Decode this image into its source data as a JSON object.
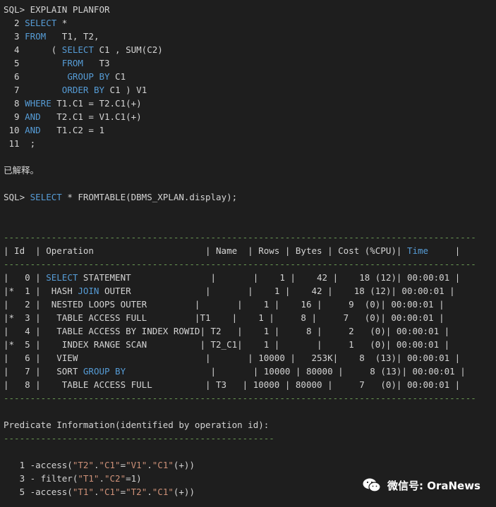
{
  "colors": {
    "background": "#1e1e1e",
    "text": "#d4d4d4",
    "keyword": "#569cd6",
    "string": "#ce9178",
    "separator": "#6a9955"
  },
  "lines": [
    [
      [
        "SQL> EXPLAIN PLANFOR",
        ""
      ]
    ],
    [
      [
        "  2 ",
        ""
      ],
      [
        "SELECT",
        "kw"
      ],
      [
        " *",
        ""
      ]
    ],
    [
      [
        "  3 ",
        ""
      ],
      [
        "FROM",
        "kw"
      ],
      [
        "   T1, T2,",
        ""
      ]
    ],
    [
      [
        "  4      ( ",
        ""
      ],
      [
        "SELECT",
        "kw"
      ],
      [
        " C1 , SUM(C2)",
        ""
      ]
    ],
    [
      [
        "  5        ",
        ""
      ],
      [
        "FROM",
        "kw"
      ],
      [
        "   T3",
        ""
      ]
    ],
    [
      [
        "  6         ",
        ""
      ],
      [
        "GROUP BY",
        "kw"
      ],
      [
        " C1",
        ""
      ]
    ],
    [
      [
        "  7        ",
        ""
      ],
      [
        "ORDER BY",
        "kw"
      ],
      [
        " C1 ) V1",
        ""
      ]
    ],
    [
      [
        "  8 ",
        ""
      ],
      [
        "WHERE",
        "kw"
      ],
      [
        " T1.C1 = T2.C1(+)",
        ""
      ]
    ],
    [
      [
        "  9 ",
        ""
      ],
      [
        "AND",
        "kw"
      ],
      [
        "   T2.C1 = V1.C1(+)",
        ""
      ]
    ],
    [
      [
        " 10 ",
        ""
      ],
      [
        "AND",
        "kw"
      ],
      [
        "   T1.C2 = 1",
        ""
      ]
    ],
    [
      [
        " 11  ;",
        ""
      ]
    ],
    [],
    [
      [
        "已解释。",
        ""
      ]
    ],
    [],
    [
      [
        "SQL> ",
        ""
      ],
      [
        "SELECT",
        "kw"
      ],
      [
        " * FROMTABLE(DBMS_XPLAN.display);",
        ""
      ]
    ],
    [],
    [],
    [
      [
        "-----------------------------------------------------------------------------------------",
        "dash"
      ]
    ],
    [
      [
        "| Id  | Operation                     | Name  | Rows | Bytes | Cost (%CPU)| ",
        ""
      ],
      [
        "Time",
        "kw"
      ],
      [
        "     |",
        ""
      ]
    ],
    [
      [
        "-----------------------------------------------------------------------------------------",
        "dash"
      ]
    ],
    [
      [
        "|   0 | ",
        ""
      ],
      [
        "SELECT",
        "kw"
      ],
      [
        " STATEMENT               |       |    1 |    42 |    18 (12)| 00:00:01 |",
        ""
      ]
    ],
    [
      [
        "|*  1 |  HASH ",
        ""
      ],
      [
        "JOIN",
        "kw"
      ],
      [
        " OUTER              |       |    1 |    42 |    18 (12)| 00:00:01 |",
        ""
      ]
    ],
    [
      [
        "|   2 |  NESTED LOOPS OUTER         |       |    1 |    16 |     9  (0)| 00:00:01 |",
        ""
      ]
    ],
    [
      [
        "|*  3 |   TABLE ACCESS FULL         |T1    |    1 |     8 |     7   (0)| 00:00:01 |",
        ""
      ]
    ],
    [
      [
        "|   4 |   TABLE ACCESS BY INDEX ROWID| T2   |    1 |     8 |     2   (0)| 00:00:01 |",
        ""
      ]
    ],
    [
      [
        "|*  5 |    INDEX RANGE SCAN          | T2_C1|    1 |       |     1   (0)| 00:00:01 |",
        ""
      ]
    ],
    [
      [
        "|   6 |   VIEW                        |       | 10000 |   253K|    8  (13)| 00:00:01 |",
        ""
      ]
    ],
    [
      [
        "|   7 |   SORT ",
        ""
      ],
      [
        "GROUP BY",
        "kw"
      ],
      [
        "                |       | 10000 | 80000 |     8 (13)| 00:00:01 |",
        ""
      ]
    ],
    [
      [
        "|   8 |    TABLE ACCESS FULL          | T3   | 10000 | 80000 |     7   (0)| 00:00:01 |",
        ""
      ]
    ],
    [
      [
        "-----------------------------------------------------------------------------------------",
        "dash"
      ]
    ],
    [],
    [
      [
        "Predicate Information(identified by operation id):",
        ""
      ]
    ],
    [
      [
        "---------------------------------------------------",
        "dash"
      ]
    ],
    [],
    [
      [
        "   1 -access(",
        ""
      ],
      [
        "\"T2\"",
        "str"
      ],
      [
        ".",
        ""
      ],
      [
        "\"C1\"",
        "str"
      ],
      [
        "=",
        ""
      ],
      [
        "\"V1\"",
        "str"
      ],
      [
        ".",
        ""
      ],
      [
        "\"C1\"",
        "str"
      ],
      [
        "(+))",
        ""
      ]
    ],
    [
      [
        "   3 - filter(",
        ""
      ],
      [
        "\"T1\"",
        "str"
      ],
      [
        ".",
        ""
      ],
      [
        "\"C2\"",
        "str"
      ],
      [
        "=1)",
        ""
      ]
    ],
    [
      [
        "   5 -access(",
        ""
      ],
      [
        "\"T1\"",
        "str"
      ],
      [
        ".",
        ""
      ],
      [
        "\"C1\"",
        "str"
      ],
      [
        "=",
        ""
      ],
      [
        "\"T2\"",
        "str"
      ],
      [
        ".",
        ""
      ],
      [
        "\"C1\"",
        "str"
      ],
      [
        "(+))",
        ""
      ]
    ]
  ],
  "watermark": {
    "icon": "wechat-icon",
    "text": "微信号: OraNews"
  }
}
